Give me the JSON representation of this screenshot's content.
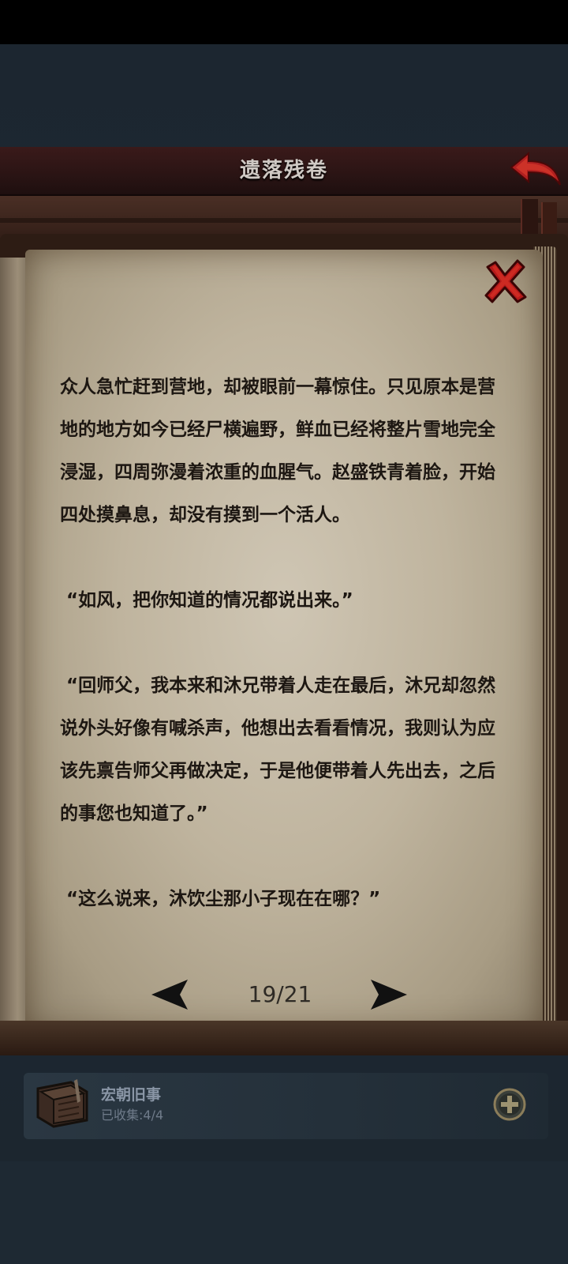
{
  "header": {
    "title": "遗落残卷"
  },
  "story": {
    "paragraphs": [
      "众人急忙赶到营地，却被眼前一幕惊住。只见原本是营地的地方如今已经尸横遍野，鲜血已经将整片雪地完全浸湿，四周弥漫着浓重的血腥气。赵盛铁青着脸，开始四处摸鼻息，却没有摸到一个活人。",
      " “如风，把你知道的情况都说出来。”",
      " “回师父，我本来和沐兄带着人走在最后，沐兄却忽然说外头好像有喊杀声，他想出去看看情况，我则认为应该先禀告师父再做决定，于是他便带着人先出去，之后的事您也知道了。”",
      " “这么说来，沐饮尘那小子现在在哪？”"
    ]
  },
  "pager": {
    "current": "19/21"
  },
  "collection": {
    "title": "宏朝旧事",
    "collected_label": "已收集:",
    "collected_count": "4/4"
  },
  "colors": {
    "header_bg": "#2a1414",
    "page_paper": "#bfb49e",
    "close_red": "#b51a1a",
    "text_dark": "#1d1712",
    "panel_bg": "#24303a"
  },
  "icons": {
    "back": "back-arrow-icon",
    "close": "close-x-icon",
    "prev": "triangle-left-icon",
    "next": "triangle-right-icon",
    "book": "book-icon",
    "plus": "plus-circle-icon"
  }
}
